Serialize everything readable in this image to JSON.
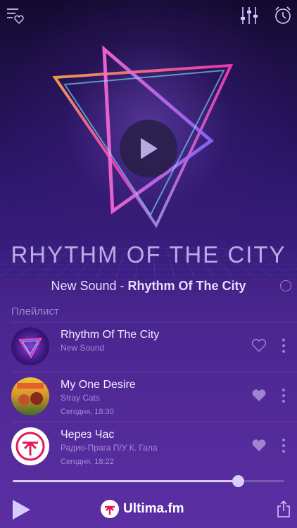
{
  "artwork": {
    "title": "RHYTHM OF THE CITY"
  },
  "now_playing": {
    "artist": "New Sound",
    "separator": " - ",
    "track": "Rhythm Of The City"
  },
  "playlist": {
    "label": "Плейлист",
    "items": [
      {
        "title": "Rhythm Of The City",
        "artist": "New Sound",
        "time": "",
        "liked": false
      },
      {
        "title": "My One Desire",
        "artist": "Stray Cats",
        "time": "Сегодня, 18:30",
        "liked": true
      },
      {
        "title": "Через Час",
        "artist": "Радио-Прага П/У К. Гала",
        "time": "Сегодня, 18:22",
        "liked": true
      }
    ]
  },
  "volume": 0.83,
  "brand": {
    "name": "Ultima.fm"
  },
  "colors": {
    "accent": "#d9cef5",
    "background": "#3a1d78",
    "brand_logo": "#e2185b"
  }
}
